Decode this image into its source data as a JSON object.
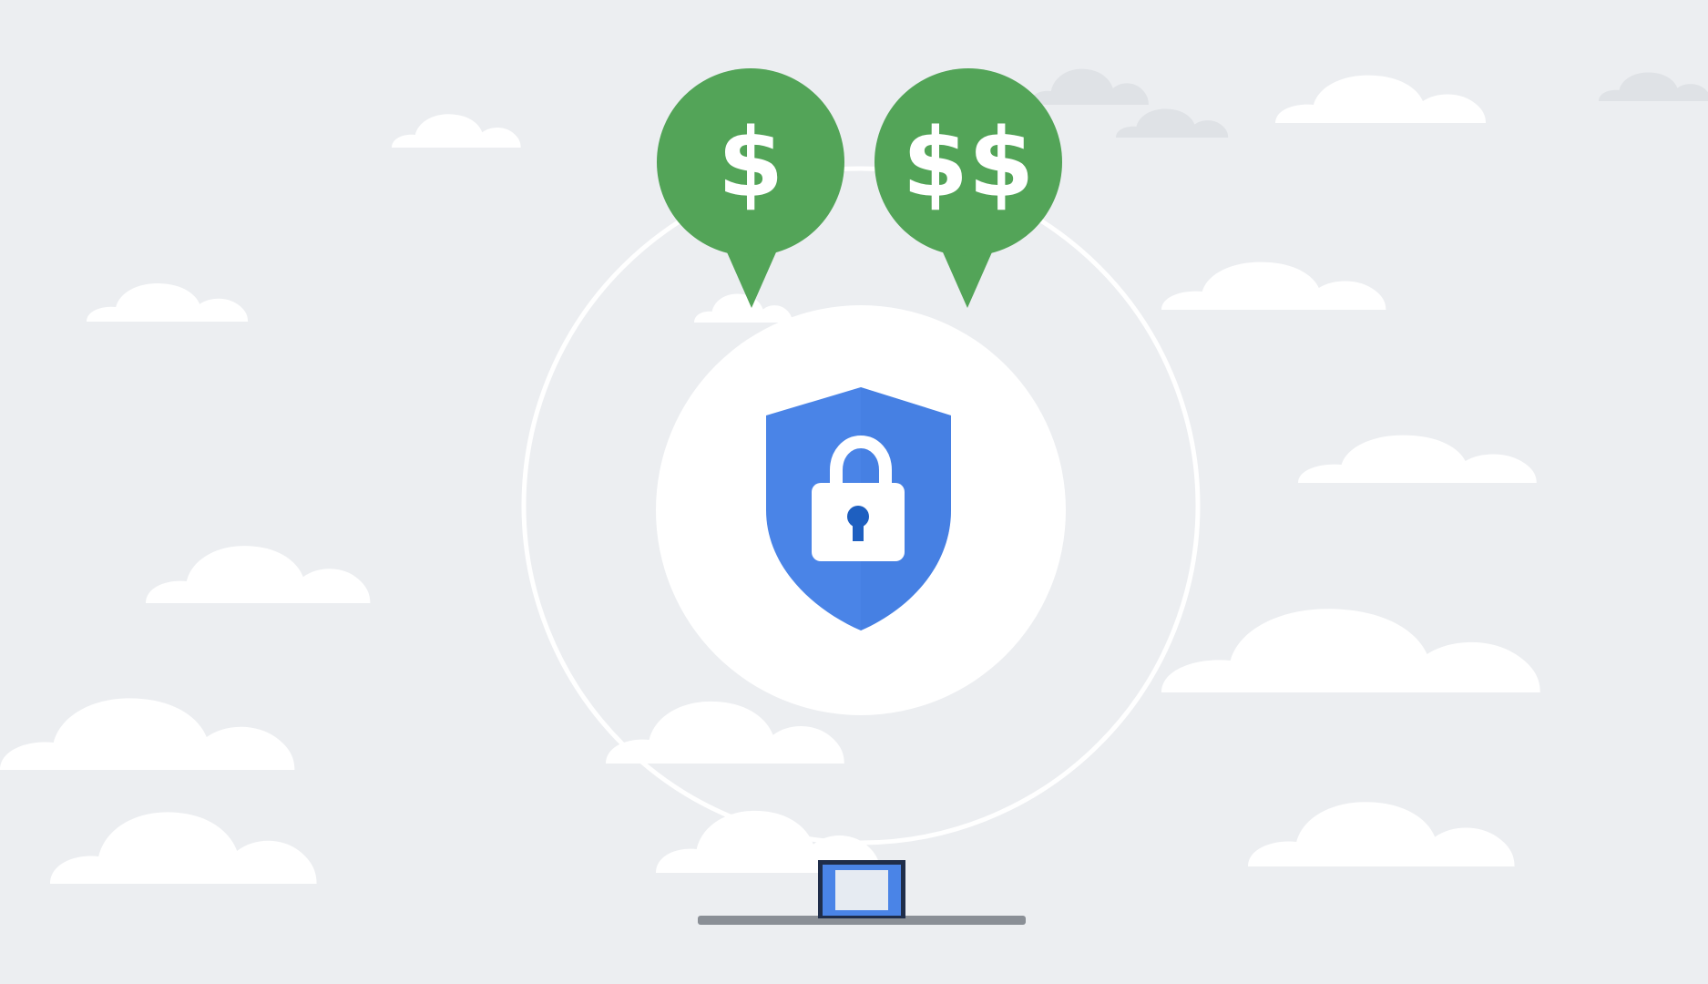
{
  "scene": {
    "description_free": true,
    "icons": {
      "shield": "shield-lock-icon",
      "laptop": "laptop-icon",
      "cloud": "cloud-icon"
    },
    "colors": {
      "background": "#eceef1",
      "cloud": "#ffffff",
      "cloud_faint": "#dfe2e6",
      "ring": "#ffffff",
      "shield": "#4a84e7",
      "shield_shade": "#3f78dc",
      "lock_body": "#ffffff",
      "keyhole": "#1e5fc0",
      "pin_green": "#53a458",
      "laptop_frame": "#1f2d4a",
      "laptop_screen": "#4a84e7",
      "laptop_base": "#8a8f96"
    },
    "price_pins": [
      {
        "label": "$"
      },
      {
        "label": "$$"
      }
    ]
  }
}
